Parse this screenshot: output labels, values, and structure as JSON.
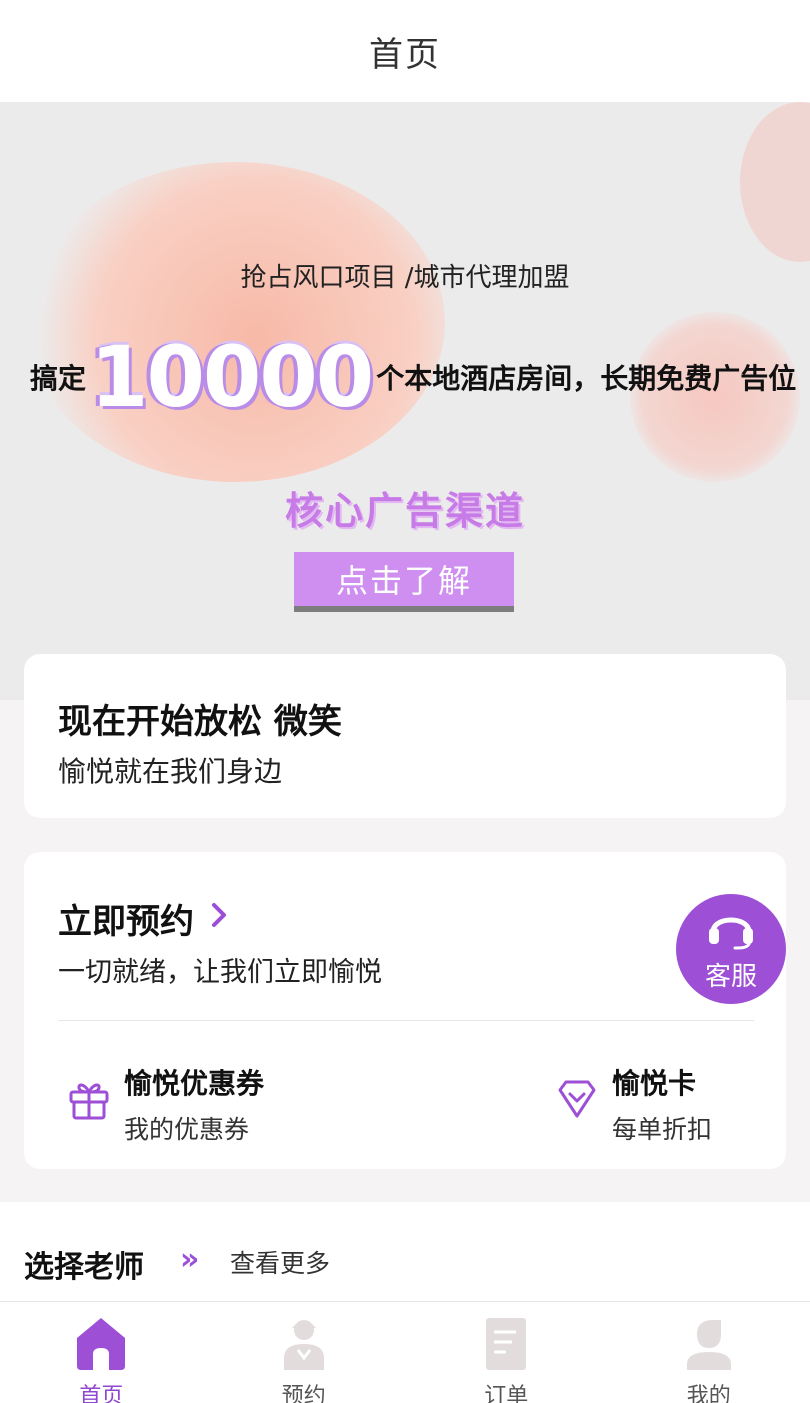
{
  "navbar": {
    "title": "首页"
  },
  "banner": {
    "subtitle": "抢占风口项目 /城市代理加盟",
    "headline_prefix": "搞定",
    "headline_number": "10000",
    "headline_suffix": "个本地酒店房间，长期免费广告位",
    "channel": "核心广告渠道",
    "cta_label": "点击了解"
  },
  "relax_card": {
    "title": "现在开始放松 微笑",
    "subtitle": "愉悦就在我们身边"
  },
  "booking_card": {
    "title": "立即预约",
    "chevron_icon": "chevron-right-icon",
    "subtitle": "一切就绪，让我们立即愉悦",
    "features": [
      {
        "title": "愉悦优惠券",
        "desc": "我的优惠券",
        "icon": "gift-icon"
      },
      {
        "title": "愉悦卡",
        "desc": "每单折扣",
        "icon": "diamond-icon"
      }
    ]
  },
  "service_button": {
    "label": "客服",
    "icon": "headset-icon"
  },
  "teachers": {
    "title": "选择老师",
    "arrows": "»",
    "more": "查看更多"
  },
  "tabbar": {
    "items": [
      {
        "label": "首页",
        "icon": "home-icon",
        "active": true
      },
      {
        "label": "预约",
        "icon": "person-icon",
        "active": false
      },
      {
        "label": "订单",
        "icon": "document-icon",
        "active": false
      },
      {
        "label": "我的",
        "icon": "user-icon",
        "active": false
      }
    ]
  },
  "colors": {
    "accent": "#9d4fd6",
    "tab_active": "#8f47d0",
    "tab_inactive": "#e2dcdc",
    "cta_bg": "#cf8ff0"
  }
}
